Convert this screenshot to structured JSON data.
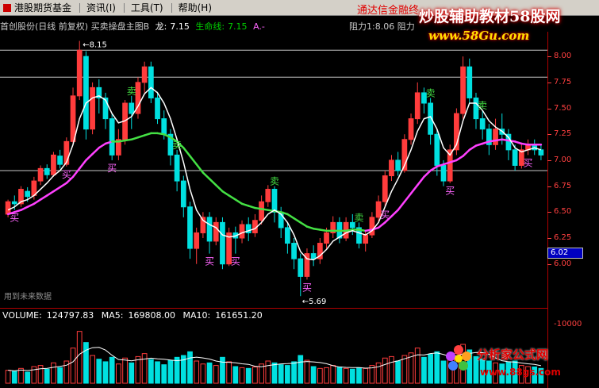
{
  "menu": {
    "items": [
      "港股期货基金",
      "资讯(I)",
      "工具(T)",
      "帮助(H)"
    ]
  },
  "ad": {
    "red_text": "通达信金融终",
    "brand": "炒股辅助教材58股网",
    "brand_url": "www.58Gu.com"
  },
  "title": {
    "security": "首创股份(日线 前复权) 买卖操盘主图B",
    "dragon_label": "龙:",
    "dragon_value": "7.15",
    "life_label": "生命线:",
    "life_value": "7.15",
    "arrow": "A.-",
    "resist1_label": "阻力1:",
    "resist1_value": "8.06",
    "resist2_label": "阻力"
  },
  "colors": {
    "up": "#ff3c3c",
    "down": "#00e0e0",
    "dragon_line": "#ffffff",
    "life_line_bull": "#ff40ff",
    "life_line_bear": "#44e044",
    "axis": "#ff4040",
    "brand_glow": "#cc0000"
  },
  "axis": {
    "ticks": [
      "8.00",
      "7.75",
      "7.50",
      "7.25",
      "7.00",
      "6.75",
      "6.50",
      "6.25",
      "6.00"
    ],
    "volume_ticks": [
      "10000"
    ],
    "current_price": "6.02"
  },
  "annotations": {
    "high_label": "8.15",
    "low_label": "5.69",
    "buy": "买",
    "sell": "卖",
    "future_note": "用到未来数据"
  },
  "volume": {
    "label": "VOLUME:",
    "value": "124797.83",
    "ma5_label": "MA5:",
    "ma5_value": "169808.00",
    "ma10_label": "MA10:",
    "ma10_value": "161651.20"
  },
  "watermark2": {
    "title": "分析家公式网",
    "url": "www.88gs.com"
  },
  "chart_data": {
    "type": "candlestick",
    "ylim": [
      5.6,
      8.2
    ],
    "candles": [
      [
        6.48,
        6.6,
        6.45,
        6.62
      ],
      [
        6.6,
        6.58,
        6.52,
        6.66
      ],
      [
        6.58,
        6.72,
        6.55,
        6.75
      ],
      [
        6.7,
        6.65,
        6.6,
        6.74
      ],
      [
        6.66,
        6.8,
        6.62,
        6.84
      ],
      [
        6.8,
        6.92,
        6.76,
        6.95
      ],
      [
        6.92,
        6.86,
        6.82,
        6.96
      ],
      [
        6.86,
        7.05,
        6.84,
        7.08
      ],
      [
        7.04,
        6.96,
        6.92,
        7.1
      ],
      [
        6.96,
        7.18,
        6.94,
        7.22
      ],
      [
        7.18,
        7.62,
        7.15,
        7.7
      ],
      [
        7.62,
        8.06,
        7.58,
        8.15
      ],
      [
        8.0,
        7.3,
        7.2,
        8.05
      ],
      [
        7.3,
        7.7,
        7.25,
        7.75
      ],
      [
        7.7,
        7.6,
        7.45,
        7.78
      ],
      [
        7.6,
        7.4,
        7.3,
        7.65
      ],
      [
        7.4,
        7.05,
        7.0,
        7.45
      ],
      [
        7.05,
        7.2,
        7.0,
        7.3
      ],
      [
        7.2,
        7.55,
        7.15,
        7.58
      ],
      [
        7.55,
        7.45,
        7.3,
        7.62
      ],
      [
        7.45,
        7.75,
        7.4,
        7.8
      ],
      [
        7.75,
        7.9,
        7.65,
        7.95
      ],
      [
        7.9,
        7.6,
        7.55,
        7.95
      ],
      [
        7.6,
        7.4,
        7.35,
        7.66
      ],
      [
        7.4,
        7.25,
        7.2,
        7.48
      ],
      [
        7.25,
        7.05,
        6.95,
        7.3
      ],
      [
        7.05,
        6.8,
        6.7,
        7.1
      ],
      [
        6.8,
        6.55,
        6.45,
        6.85
      ],
      [
        6.55,
        6.15,
        6.05,
        6.6
      ],
      [
        6.15,
        6.3,
        6.0,
        6.35
      ],
      [
        6.3,
        6.45,
        6.25,
        6.5
      ],
      [
        6.45,
        6.22,
        6.1,
        6.5
      ],
      [
        6.22,
        6.4,
        6.18,
        6.45
      ],
      [
        6.4,
        6.0,
        5.95,
        6.45
      ],
      [
        6.0,
        6.3,
        5.98,
        6.35
      ],
      [
        6.3,
        6.25,
        6.1,
        6.36
      ],
      [
        6.25,
        6.38,
        6.2,
        6.42
      ],
      [
        6.38,
        6.3,
        6.22,
        6.45
      ],
      [
        6.3,
        6.42,
        6.26,
        6.48
      ],
      [
        6.42,
        6.6,
        6.38,
        6.66
      ],
      [
        6.6,
        6.72,
        6.55,
        6.76
      ],
      [
        6.72,
        6.5,
        6.4,
        6.75
      ],
      [
        6.5,
        6.35,
        6.25,
        6.55
      ],
      [
        6.35,
        6.2,
        6.1,
        6.4
      ],
      [
        6.2,
        6.05,
        5.95,
        6.25
      ],
      [
        6.05,
        5.88,
        5.69,
        6.1
      ],
      [
        5.88,
        6.1,
        5.85,
        6.15
      ],
      [
        6.1,
        6.05,
        5.98,
        6.18
      ],
      [
        6.05,
        6.2,
        6.0,
        6.25
      ],
      [
        6.2,
        6.3,
        6.15,
        6.35
      ],
      [
        6.3,
        6.4,
        6.25,
        6.46
      ],
      [
        6.4,
        6.25,
        6.2,
        6.45
      ],
      [
        6.25,
        6.4,
        6.22,
        6.45
      ],
      [
        6.4,
        6.35,
        6.28,
        6.48
      ],
      [
        6.35,
        6.2,
        6.15,
        6.4
      ],
      [
        6.2,
        6.28,
        6.12,
        6.32
      ],
      [
        6.28,
        6.45,
        6.25,
        6.5
      ],
      [
        6.45,
        6.6,
        6.4,
        6.66
      ],
      [
        6.6,
        6.85,
        6.55,
        6.9
      ],
      [
        6.85,
        7.0,
        6.8,
        7.05
      ],
      [
        7.0,
        6.9,
        6.85,
        7.08
      ],
      [
        6.9,
        7.2,
        6.88,
        7.25
      ],
      [
        7.2,
        7.4,
        7.15,
        7.45
      ],
      [
        7.4,
        7.65,
        7.35,
        7.75
      ],
      [
        7.65,
        7.55,
        7.45,
        7.7
      ],
      [
        7.55,
        7.25,
        7.15,
        7.6
      ],
      [
        7.25,
        6.95,
        6.85,
        7.3
      ],
      [
        6.95,
        6.8,
        6.75,
        7.0
      ],
      [
        6.8,
        7.1,
        6.78,
        7.15
      ],
      [
        7.1,
        7.45,
        7.05,
        7.5
      ],
      [
        7.45,
        7.9,
        7.4,
        8.0
      ],
      [
        7.9,
        7.6,
        7.55,
        7.98
      ],
      [
        7.6,
        7.4,
        7.3,
        7.65
      ],
      [
        7.4,
        7.3,
        7.2,
        7.48
      ],
      [
        7.3,
        7.15,
        7.05,
        7.35
      ],
      [
        7.15,
        7.3,
        7.1,
        7.4
      ],
      [
        7.3,
        7.25,
        7.15,
        7.45
      ],
      [
        7.25,
        7.1,
        7.0,
        7.3
      ],
      [
        7.1,
        6.95,
        6.9,
        7.15
      ],
      [
        6.95,
        7.1,
        6.92,
        7.15
      ],
      [
        7.1,
        7.15,
        7.05,
        7.2
      ],
      [
        7.15,
        7.1,
        7.05,
        7.2
      ],
      [
        7.1,
        7.05,
        7.0,
        7.15
      ]
    ],
    "volumes": [
      35,
      32,
      40,
      30,
      45,
      48,
      38,
      55,
      42,
      60,
      95,
      140,
      110,
      75,
      65,
      58,
      70,
      52,
      68,
      55,
      72,
      80,
      64,
      58,
      50,
      62,
      70,
      75,
      85,
      60,
      52,
      55,
      48,
      70,
      58,
      45,
      42,
      40,
      44,
      52,
      60,
      55,
      50,
      48,
      58,
      75,
      62,
      45,
      40,
      42,
      48,
      44,
      40,
      38,
      42,
      40,
      48,
      55,
      68,
      72,
      60,
      75,
      82,
      95,
      70,
      78,
      85,
      60,
      68,
      80,
      105,
      90,
      72,
      65,
      60,
      55,
      52,
      58,
      60,
      48,
      45,
      44,
      40
    ],
    "dragon_line": [
      6.52,
      6.55,
      6.6,
      6.62,
      6.66,
      6.72,
      6.78,
      6.85,
      6.9,
      6.98,
      7.15,
      7.4,
      7.55,
      7.6,
      7.62,
      7.58,
      7.45,
      7.36,
      7.38,
      7.42,
      7.52,
      7.64,
      7.7,
      7.65,
      7.55,
      7.4,
      7.2,
      6.98,
      6.72,
      6.52,
      6.42,
      6.38,
      6.35,
      6.28,
      6.26,
      6.27,
      6.3,
      6.32,
      6.34,
      6.4,
      6.48,
      6.52,
      6.48,
      6.4,
      6.28,
      6.12,
      6.05,
      6.04,
      6.08,
      6.14,
      6.22,
      6.26,
      6.3,
      6.32,
      6.3,
      6.28,
      6.32,
      6.4,
      6.55,
      6.7,
      6.82,
      6.95,
      7.1,
      7.28,
      7.4,
      7.42,
      7.3,
      7.12,
      7.05,
      7.15,
      7.38,
      7.55,
      7.55,
      7.48,
      7.38,
      7.32,
      7.28,
      7.22,
      7.12,
      7.08,
      7.1,
      7.12,
      7.1
    ],
    "life_line": [
      6.48,
      6.5,
      6.52,
      6.55,
      6.58,
      6.62,
      6.66,
      6.7,
      6.74,
      6.78,
      6.84,
      6.92,
      7.0,
      7.06,
      7.12,
      7.16,
      7.18,
      7.18,
      7.19,
      7.2,
      7.22,
      7.24,
      7.26,
      7.26,
      7.25,
      7.22,
      7.18,
      7.12,
      7.04,
      6.96,
      6.88,
      6.82,
      6.76,
      6.7,
      6.66,
      6.62,
      6.58,
      6.56,
      6.54,
      6.53,
      6.52,
      6.51,
      6.5,
      6.48,
      6.44,
      6.4,
      6.36,
      6.34,
      6.33,
      6.32,
      6.32,
      6.32,
      6.32,
      6.33,
      6.33,
      6.32,
      6.33,
      6.35,
      6.4,
      6.46,
      6.52,
      6.6,
      6.68,
      6.76,
      6.84,
      6.9,
      6.94,
      6.96,
      6.98,
      7.0,
      7.04,
      7.1,
      7.14,
      7.16,
      7.18,
      7.19,
      7.2,
      7.19,
      7.18,
      7.16,
      7.15,
      7.15,
      7.15
    ],
    "life_line_trend": [
      "bull",
      "bull",
      "bull",
      "bull",
      "bull",
      "bull",
      "bull",
      "bull",
      "bull",
      "bull",
      "bull",
      "bull",
      "bull",
      "bull",
      "bull",
      "bull",
      "bull",
      "bear",
      "bear",
      "bear",
      "bear",
      "bear",
      "bear",
      "bear",
      "bear",
      "bear",
      "bear",
      "bear",
      "bear",
      "bear",
      "bear",
      "bear",
      "bear",
      "bear",
      "bear",
      "bear",
      "bear",
      "bear",
      "bear",
      "bear",
      "bear",
      "bear",
      "bear",
      "bear",
      "bear",
      "bear",
      "bear",
      "bear",
      "bear",
      "bear",
      "bear",
      "bear",
      "bear",
      "bear",
      "bear",
      "bear",
      "bull",
      "bull",
      "bull",
      "bull",
      "bull",
      "bull",
      "bull",
      "bull",
      "bull",
      "bull",
      "bull",
      "bull",
      "bull",
      "bull",
      "bull",
      "bull",
      "bull",
      "bull",
      "bull",
      "bull",
      "bull",
      "bull",
      "bull",
      "bull",
      "bull",
      "bull",
      "bull"
    ],
    "signals": [
      {
        "i": 1,
        "type": "buy"
      },
      {
        "i": 9,
        "type": "buy"
      },
      {
        "i": 16,
        "type": "buy"
      },
      {
        "i": 19,
        "type": "sell"
      },
      {
        "i": 26,
        "type": "sell"
      },
      {
        "i": 31,
        "type": "buy"
      },
      {
        "i": 35,
        "type": "buy"
      },
      {
        "i": 41,
        "type": "sell"
      },
      {
        "i": 46,
        "type": "buy"
      },
      {
        "i": 54,
        "type": "sell"
      },
      {
        "i": 58,
        "type": "buy"
      },
      {
        "i": 65,
        "type": "sell"
      },
      {
        "i": 68,
        "type": "buy"
      },
      {
        "i": 73,
        "type": "sell"
      },
      {
        "i": 80,
        "type": "buy"
      }
    ],
    "hlines": [
      8.06,
      7.8,
      6.9
    ]
  }
}
